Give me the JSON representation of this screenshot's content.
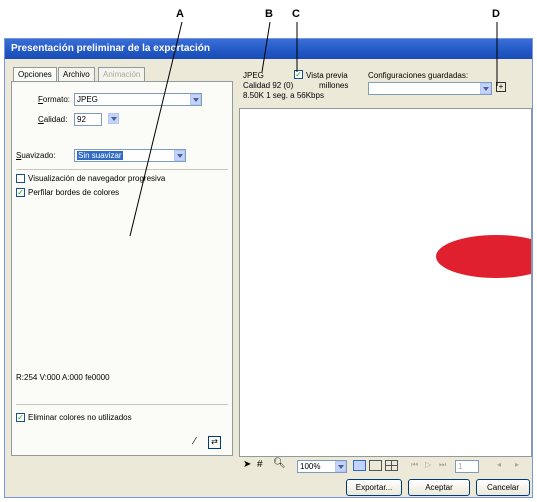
{
  "callouts": {
    "a": "A",
    "b": "B",
    "c": "C",
    "d": "D"
  },
  "window": {
    "title": "Presentación preliminar de la exportación"
  },
  "tabs": [
    {
      "label": "Opciones"
    },
    {
      "label": "Archivo"
    },
    {
      "label": "Animación"
    }
  ],
  "options": {
    "format_label": "Formato:",
    "format_value": "JPEG",
    "quality_label": "Calidad:",
    "quality_value": "92",
    "smoothing_label": "Suavizado:",
    "smoothing_value": "Sin suavizar",
    "progressive_label": "Visualización de navegador progresiva",
    "sharpen_label": "Perfilar bordes de colores",
    "color_readout": "R:254 V:000 A:000 fe0000",
    "remove_unused_label": "Eliminar colores no utilizados"
  },
  "preview_info": {
    "format": "JPEG",
    "quality": "Calidad 92 (0)",
    "size": "8.50K  1 seg. a 56Kbps",
    "preview_label": "Vista previa",
    "colors": "millones",
    "saved_label": "Configuraciones guardadas:",
    "saved_value": ""
  },
  "preview": {
    "shape_color": "#e0202e"
  },
  "toolbar": {
    "zoom_value": "100%",
    "frame_value": "1"
  },
  "buttons": {
    "export": "Exportar...",
    "ok": "Aceptar",
    "cancel": "Cancelar"
  }
}
